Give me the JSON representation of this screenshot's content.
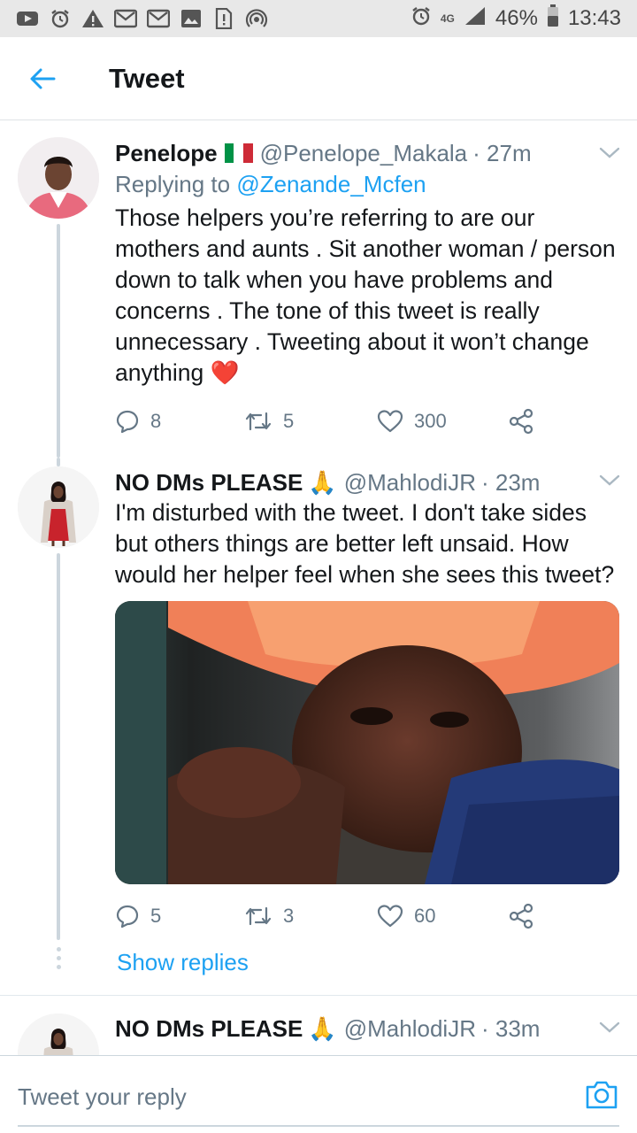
{
  "status_bar": {
    "left_icons": [
      "youtube-icon",
      "alarm-icon",
      "warning-icon",
      "gmail-icon",
      "gmail-icon",
      "image-icon",
      "sim-alert-icon",
      "hotspot-icon"
    ],
    "network": "4G",
    "battery": "46%",
    "time": "13:43"
  },
  "header": {
    "title": "Tweet"
  },
  "tweets": [
    {
      "name": "Penelope",
      "handle": "@Penelope_Makala",
      "time": "· 27m",
      "reply_prefix": "Replying to ",
      "reply_to": "@Zenande_Mcfen",
      "text": "Those helpers you’re referring to are our mothers and aunts . Sit another woman / person down to talk when you have problems and concerns . The tone of this tweet is really unnecessary . Tweeting about it won’t change anything",
      "text_emoji": "❤️",
      "replies": "8",
      "retweets": "5",
      "likes": "300"
    },
    {
      "name": "NO DMs PLEASE",
      "name_emoji": "🙏",
      "handle": "@MahlodiJR",
      "time": "· 23m",
      "text": "I'm disturbed with the tweet. I don't take sides but others things are better left unsaid. How would her helper feel when she sees this tweet?",
      "replies": "5",
      "retweets": "3",
      "likes": "60",
      "show_replies": "Show replies"
    },
    {
      "name": "NO DMs PLEASE",
      "name_emoji": "🙏",
      "handle": "@MahlodiJR",
      "time": "· 33m"
    }
  ],
  "reply_bar": {
    "placeholder": "Tweet your reply"
  },
  "colors": {
    "accent": "#1da1f2",
    "text": "#14171a",
    "secondary": "#657786",
    "like": "#e0245e"
  }
}
